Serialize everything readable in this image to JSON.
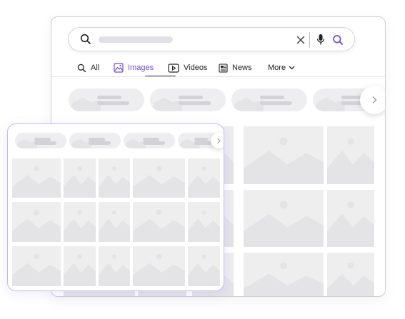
{
  "search": {
    "icons": [
      "search-icon",
      "clear-icon",
      "microphone-icon",
      "lens-icon"
    ],
    "accent_color": "#6d4ad6"
  },
  "tabs": [
    {
      "label": "All",
      "icon": "search-icon",
      "active": false
    },
    {
      "label": "Images",
      "icon": "image-icon",
      "active": true
    },
    {
      "label": "Videos",
      "icon": "video-icon",
      "active": false
    },
    {
      "label": "News",
      "icon": "newspaper-icon",
      "active": false
    },
    {
      "label": "More",
      "icon": "chevron-down-icon",
      "active": false
    }
  ],
  "colors": {
    "placeholder": "#eeeeef",
    "placeholder_dark": "#d3d3d7",
    "overlay_border": "#c9b8f4"
  }
}
